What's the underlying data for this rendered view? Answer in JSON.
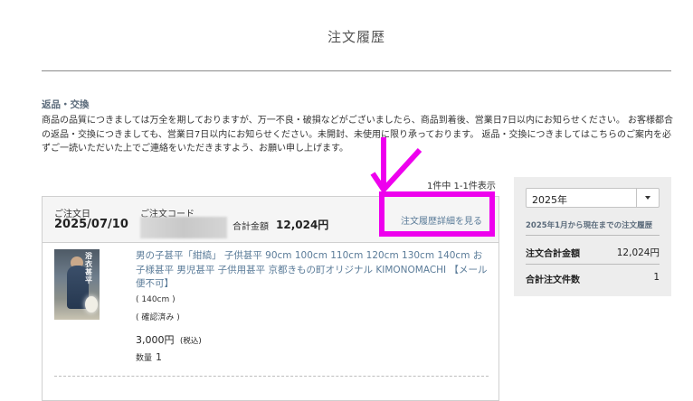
{
  "page": {
    "title": "注文履歴"
  },
  "returns": {
    "heading": "返品・交換",
    "text": "商品の品質につきましては万全を期しておりますが、万一不良・破損などがございましたら、商品到着後、営業日7日以内にお知らせください。 お客様都合の返品・交換につきましても、営業日7日以内にお知らせください。未開封、未使用に限り承っております。 返品・交換につきましてはこちらのご案内を必ずご一読いただいた上でご連絡をいただきますよう、お願い申し上げます。"
  },
  "result_count": "1件中 1-1件表示",
  "order": {
    "date_label": "ご注文日",
    "date": "2025/07/10",
    "code_label": "ご注文コード",
    "total_label": "合計金額",
    "total": "12,024円",
    "detail_link": "注文履歴詳細を見る",
    "item": {
      "name": "男の子甚平「紺縞」 子供甚平 90cm 100cm 110cm 120cm 130cm 140cm お子様甚平 男児甚平 子供用甚平 京都きもの町オリジナル KIMONOMACHI 【メール便不可】",
      "thumb_text": "浴衣甚平",
      "size": "( 140cm )",
      "status": "( 確認済み )",
      "price": "3,000円",
      "tax": "(税込)",
      "qty_label": "数量",
      "qty": "1"
    }
  },
  "sidebar": {
    "year": "2025年",
    "period": "2025年1月から現在までの注文履歴",
    "total_label": "注文合計金額",
    "total_value": "12,024円",
    "count_label": "合計注文件数",
    "count_value": "1"
  },
  "colors": {
    "highlight": "#ee00ee",
    "link": "#5b7c99"
  },
  "icons": [
    "arrow-down-icon",
    "chevron-down-icon"
  ]
}
